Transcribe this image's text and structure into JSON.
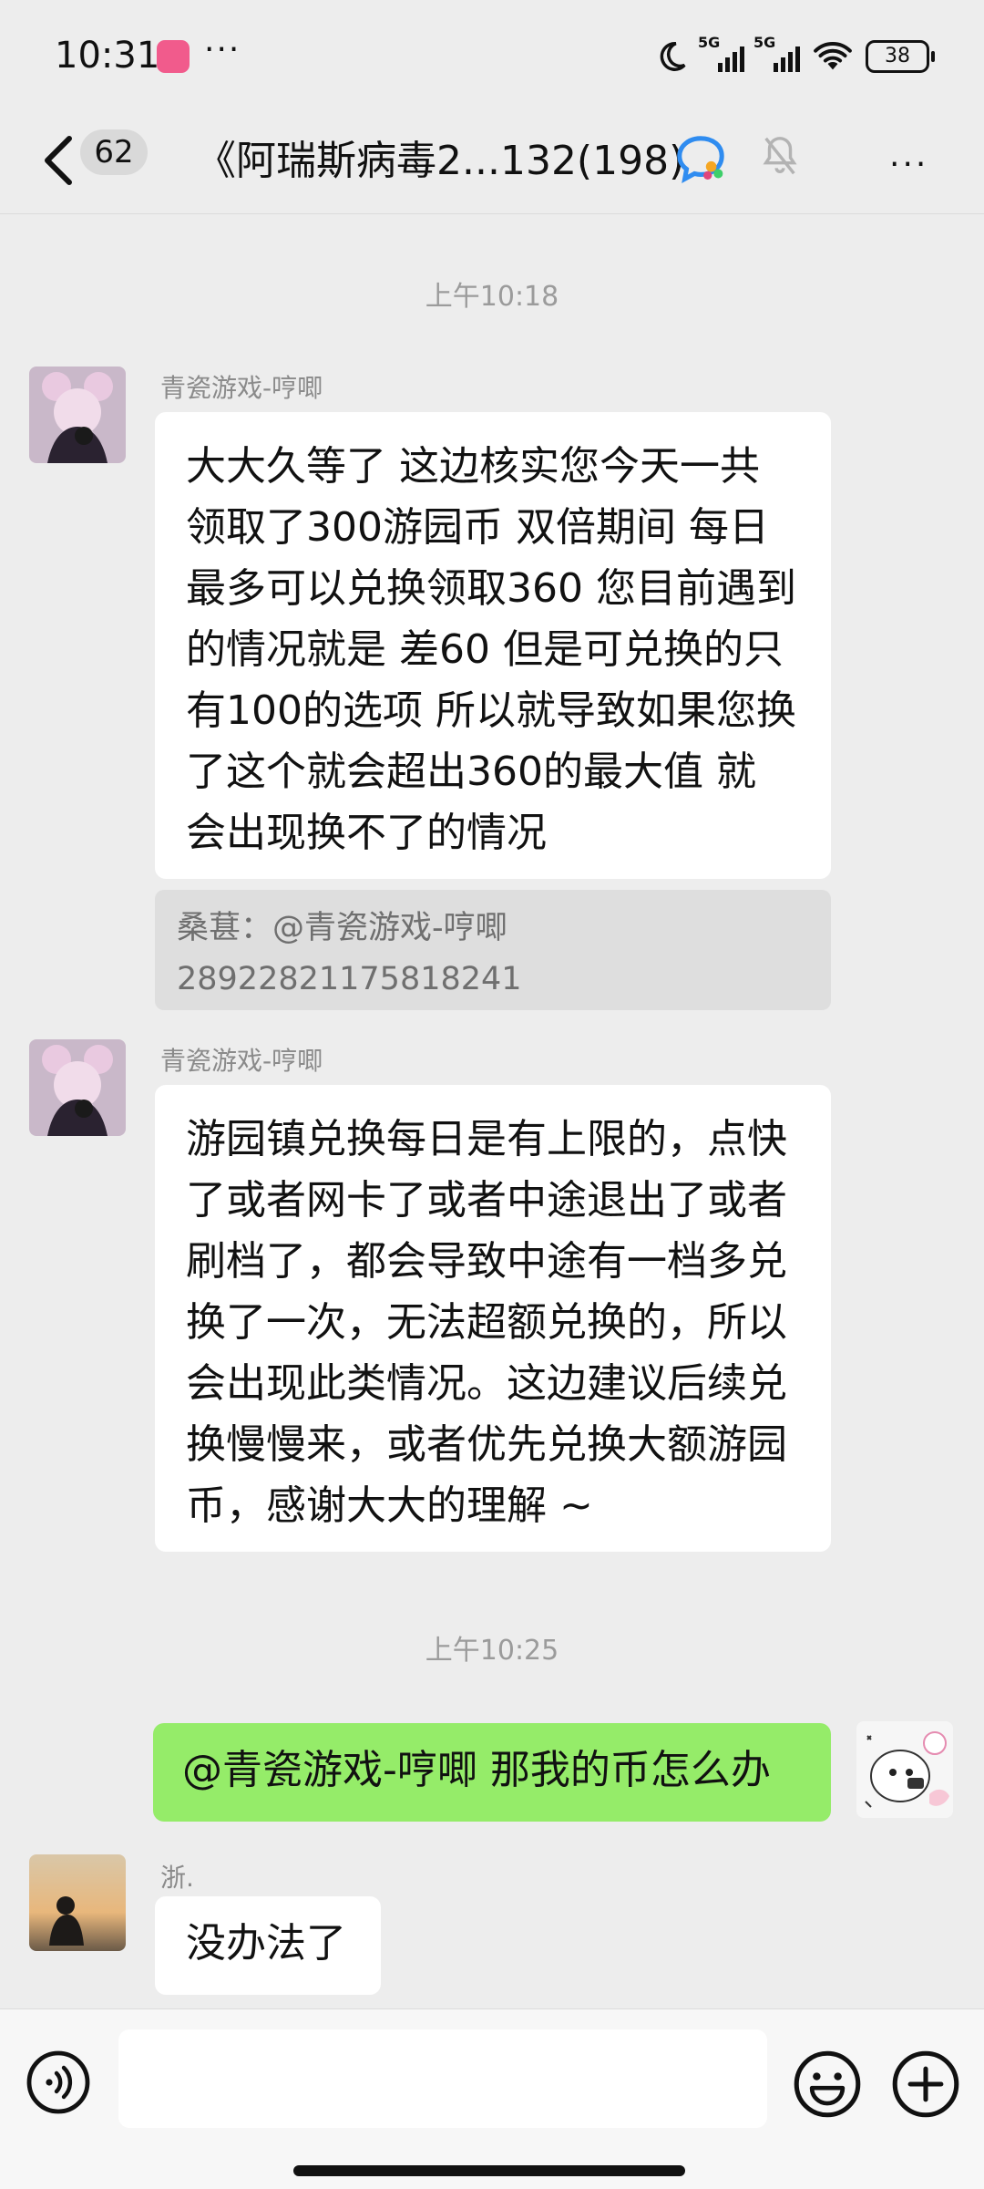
{
  "status_bar": {
    "time": "10:31",
    "more": "···",
    "net1": "5G",
    "net2": "5G",
    "battery": "38"
  },
  "header": {
    "unread_count": "62",
    "title": "《阿瑞斯病毒2...132(198)",
    "more": "···"
  },
  "messages": {
    "time1": "上午10:18",
    "m1": {
      "sender": "青瓷游戏-哼唧",
      "lines": [
        "大大久等了 这边核实您今天一共",
        "领取了300游园币 双倍期间 每日",
        "最多可以兑换领取360 您目前遇到",
        "的情况就是 差60  但是可兑换的只",
        "有100的选项 所以就导致如果您换",
        "了这个就会超出360的最大值 就",
        "会出现换不了的情况"
      ],
      "quote_line1": "桑葚：@青瓷游戏-哼唧",
      "quote_line2": "28922821175818241"
    },
    "m2": {
      "sender": "青瓷游戏-哼唧",
      "lines": [
        "游园镇兑换每日是有上限的，点快",
        "了或者网卡了或者中途退出了或者",
        "刷档了，都会导致中途有一档多兑",
        "换了一次，无法超额兑换的，所以",
        "会出现此类情况。这边建议后续兑",
        "换慢慢来，或者优先兑换大额游园",
        "币，感谢大大的理解 ~"
      ]
    },
    "time2": "上午10:25",
    "m3": {
      "text": "@青瓷游戏-哼唧  那我的币怎么办"
    },
    "m4": {
      "sender": "浙.",
      "text": "没办法了"
    }
  },
  "colors": {
    "background": "#ededed",
    "bubble_in": "#ffffff",
    "bubble_out": "#95ec69",
    "quote": "#dedede"
  }
}
